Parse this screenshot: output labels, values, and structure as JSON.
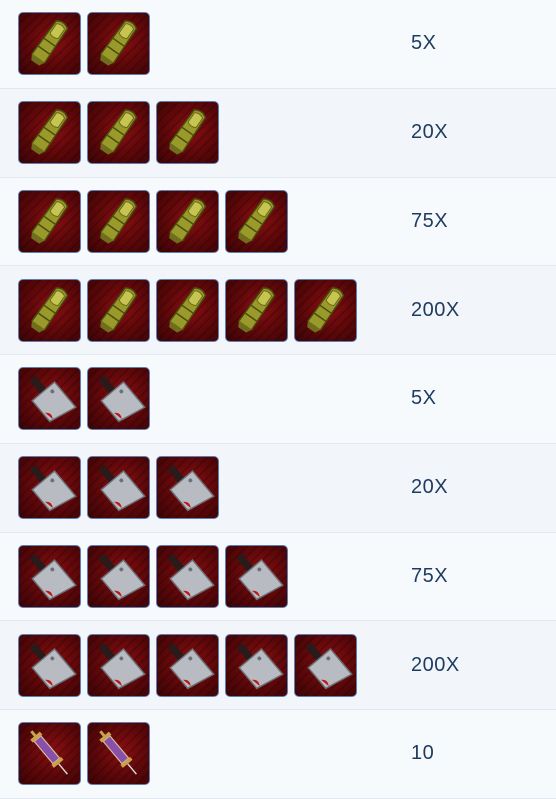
{
  "rows": [
    {
      "item": "finger-icon",
      "count": 2,
      "value": "5X"
    },
    {
      "item": "finger-icon",
      "count": 3,
      "value": "20X"
    },
    {
      "item": "finger-icon",
      "count": 4,
      "value": "75X"
    },
    {
      "item": "finger-icon",
      "count": 5,
      "value": "200X"
    },
    {
      "item": "cleaver-icon",
      "count": 2,
      "value": "5X"
    },
    {
      "item": "cleaver-icon",
      "count": 3,
      "value": "20X"
    },
    {
      "item": "cleaver-icon",
      "count": 4,
      "value": "75X"
    },
    {
      "item": "cleaver-icon",
      "count": 5,
      "value": "200X"
    },
    {
      "item": "syringe-icon",
      "count": 2,
      "value": "10"
    }
  ]
}
